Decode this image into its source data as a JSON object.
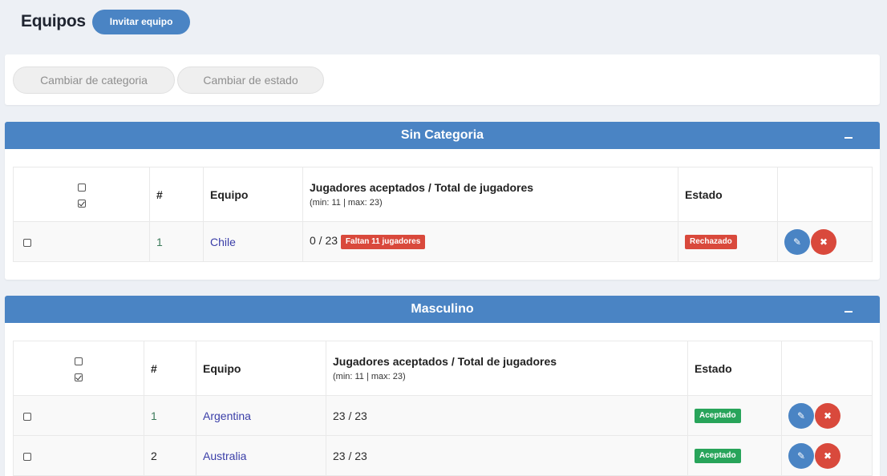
{
  "header": {
    "title": "Equipos",
    "invite_label": "Invitar equipo"
  },
  "toolbar": {
    "change_category_label": "Cambiar de categoria",
    "change_state_label": "Cambiar de estado"
  },
  "columns": {
    "number": "#",
    "team": "Equipo",
    "players": "Jugadores aceptados / Total de jugadores",
    "players_sub": "(min: 11 | max: 23)",
    "state": "Estado"
  },
  "icons": {
    "edit": "edit-icon",
    "delete": "close-icon",
    "collapse": "minus-icon"
  },
  "colors": {
    "accent": "#4a84c4",
    "danger": "#d9493c",
    "success": "#28a45a"
  },
  "sections": [
    {
      "title": "Sin Categoria",
      "rows": [
        {
          "number": "1",
          "team": "Chile",
          "players": "0 / 23",
          "warning": "Faltan 11 jugadores",
          "state": "Rechazado"
        }
      ]
    },
    {
      "title": "Masculino",
      "rows": [
        {
          "number": "1",
          "team": "Argentina",
          "players": "23 / 23",
          "state": "Aceptado"
        },
        {
          "number": "2",
          "team": "Australia",
          "players": "23 / 23",
          "state": "Aceptado"
        }
      ]
    }
  ]
}
